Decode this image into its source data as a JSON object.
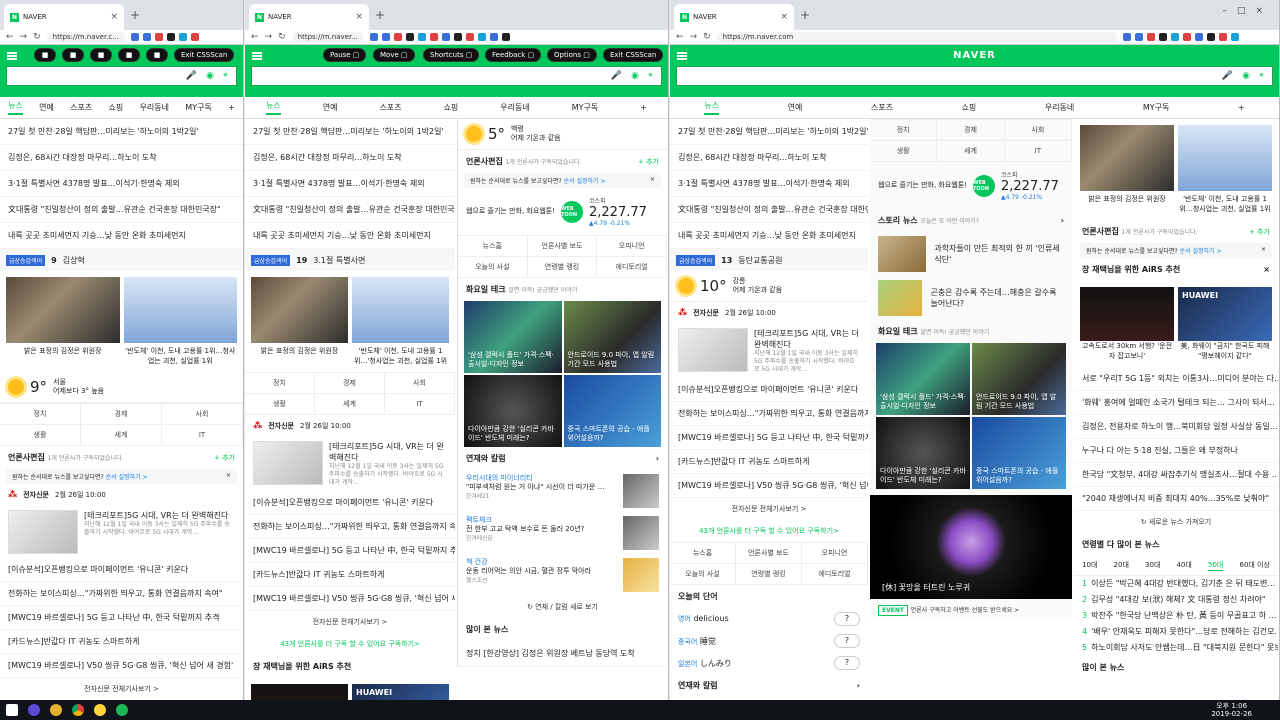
{
  "browser": {
    "tab_title": "NAVER",
    "url_short": "https://m.naver.c...",
    "url_mid": "https://m.naver...",
    "url_full": "https://m.naver.com"
  },
  "cssscan": {
    "pause": "Pause",
    "move": "Move",
    "shortcuts": "Shortcuts",
    "feedback": "Feedback",
    "options": "Options",
    "exit": "Exit CSSScan"
  },
  "naver": {
    "logo": "NAVER",
    "tabs": [
      "뉴스",
      "연예",
      "스포츠",
      "쇼핑",
      "우리동네",
      "MY구독"
    ],
    "headlines": [
      "27일 첫 만찬·28일 핵담판…미리보는 '하노이의 1박2일'",
      "김정은, 68시간 대장정 마무리…하노이 도착",
      "3·1절 특별사면 4378명 발표…이석기·한명숙 제외",
      "文대통령 \"친일청산이 정의 출발…유관순 건국훈장 대한민국장\"",
      "내륙 곳곳 초미세먼지 기승…낮 동안 온화  초미세먼지"
    ],
    "rank_badge": "급상승검색어",
    "rank_w1": {
      "num": "9",
      "word": "김상혁"
    },
    "rank_w2": {
      "num": "19",
      "word": "3.1절 특별사면"
    },
    "rank_w3": {
      "num": "13",
      "word": "동탄교통공원"
    },
    "photo_cap_1": "밝은 표정의 김정은 위원장",
    "photo_cap_2": "'반도체' 이천, 도내 고용률 1위…'청사업는 괴천, 실업률 1위",
    "photo_cap_2b": "'반도체' 이천, 도내 고용률 1위…청사업는 괴천, 실업률 1위",
    "weather_w1": {
      "temp": "9°",
      "city": "서울",
      "desc": "어제보다 3° 높음"
    },
    "weather_w2": {
      "temp": "5°",
      "city": "백령",
      "desc": "어제 기온과 같음"
    },
    "weather_w3": {
      "temp": "10°",
      "city": "강릉",
      "desc": "어제 기온과 같음"
    },
    "cats": [
      "정치",
      "경제",
      "사회",
      "생활",
      "세계",
      "IT"
    ],
    "editor_title": "언론사편집",
    "editor_sub": "1개 언론사가 구독되었습니다.",
    "editor_add": "+ 추가",
    "notice": "원하는 순서대로 뉴스를 보고싶다면?",
    "notice_link": "순서 설정하기 >",
    "press_name": "전자신문",
    "press_date": "2월 26일 10:00",
    "feature_title": "[테크리포트]5G 시대, VR는 더 완벽해진다",
    "feature_title_w1": "[테크리포트]5G 시대, VR는 더 완벽해진다",
    "feature_sub": "지난해 12월 1일 국내 이동 3사는 일제히 5G 주파수를 송출하기 시작했다. 바야흐로 5G 시대가 개막…",
    "press_list": [
      "[이슈분석]오픈뱅킹으로 마이페이먼트 '유니콘' 키운다",
      "전화하는 보이스피싱…\"가짜위한 띄우고, 통화 연결음까지 속여\"",
      "[MWC19 바르셀로나] 5G 등고 나타난 中, 한국 턱밑까지 추격",
      "[카드뉴스]반값다 IT 귀농도 스마트하게",
      "[MWC19 바르셀로나] V50 씽큐 5G·G8 씽큐, '혁신 넘어 새 경험'"
    ],
    "press_more": "전자신문 전체기사보기 >",
    "sub_count": "43개 언론사를 더 구독 할 수 있어요",
    "sub_link": "구독하기>",
    "ad_title": "장 재택님을 위한 AiRS 추천",
    "ad_night": "고속도로서 30km 서행? '운전자 잡고보니'",
    "kospi": {
      "label": "코스피",
      "value": "2,227.77",
      "change": "▲4.79 -0.21%"
    },
    "webtoon_text": "웹으로 즐기는 만화, 화요웹툰!",
    "webtoon_badge": "WEB TOON",
    "press_links": [
      "뉴스홈",
      "언론사별 보도",
      "오피니언",
      "오늘의 사설",
      "연령별 랭킹",
      "에디토리얼"
    ],
    "tech_title": "화요일 테크",
    "tech_sub": "알면 이득! 궁금했던 이야기",
    "tech": [
      "'삼성 갤럭시 폴드' 가격·스펙·출시일·디자인 정보",
      "안드로이드 9.0 파이, 앱 알림 기간 모드 사용법",
      "다이아만큼 강한 '실리콘 카바이드' 반도체 미래는?",
      "중국 스마트폰의 공습 - 애플 위어설음까?"
    ],
    "column_title": "연재와 칼럼",
    "columns": [
      {
        "tag": "우리시대의 마이너리티",
        "title": "\"피부색처럼 원는 거 아냐\" 시선이 더 따가운 …",
        "src": "한겨레21"
      },
      {
        "tag": "팩트체크",
        "title": "전 한부 고교 탁액 보수로 돈 둘러 20년?",
        "src": "한겨레신문"
      },
      {
        "tag": "책 건강",
        "title": "운동 리어먹는 의안 시금, 혈관 장투 막아라",
        "src": "헬스조선"
      }
    ],
    "refresh": "연재 / 칼럼 새로 보기",
    "popular": "많이 본 뉴스",
    "popular_item": "정치  [한강영상] 김정은 위원장 베트남 동당역 도착",
    "word_title": "오늘의 단어",
    "words": [
      {
        "lang": "영어",
        "word": "delicious"
      },
      {
        "lang": "중국어",
        "word": "睡觉"
      },
      {
        "lang": "일본어",
        "word": "しんみり"
      }
    ],
    "word_q": "?",
    "story_title": "스토리 뉴스",
    "story_sub": "오늘은 또 어떤 이야기?",
    "stories": [
      "과학자들이 만든 최적의 한 끼 '인류세 식단'",
      "곤충은 감수록 주는데…해충은 갈수록 늘어난다?"
    ],
    "flower_cap": "[休] 꽃망울 터트린 노루귀",
    "event_badge": "EVENT",
    "event_text": "언론사 구독하고 아벤트 선물도 받으세요 >",
    "huawei": "HUAWEI",
    "right_news": [
      "서로 \"우리T 5G 1등\" 외치는 이통3사…미디어 분야는 다…",
      "'화웨' 홍여에 얼떼인 소국가 털테크 되는… 그사이 되서…",
      "김정은, 전용차로 하노이 행…북미회담 일정 사실상 동일…",
      "누구나 다 아는 5·18 진실, 그들은 왜 부정하나",
      "한국당 \"文청부, 4대강 싸잡추기식 맹실조사…절대 수용 …",
      "\"2040 재생에너지 비중 최대치 40%…35%로 낮춰야\""
    ],
    "right_more": "새로운 뉴스 가져오기",
    "age_title": "연령별 다 많이 본 뉴스",
    "ages": [
      "10대",
      "20대",
      "30대",
      "40대",
      "50대",
      "60대 이상"
    ],
    "age_rank": [
      "이상든 \"박근혜 4대강 반대했다, 김기춘 은 뒤 태도변…",
      "김무성 \"4대강 보(洑) 해체? 文 대통령 정신 차려야\"",
      "박찬주 \"한국당 난맥상은 朴 탄, 黃 등이 무골표고 하 …",
      "'배우' 안재욱도 피해자 못한다\"…당로 전해하는 김건모…",
      "하노이회담 사저도 안쌤는데…日 \"대북지원 문한다\" 못보"
    ],
    "airs_caption_1": "고속도로서 30km 서행? '운전자 잡고보니'",
    "airs_caption_2": "美, 화웨이 \"금지\" 한국도 피해 \"평보헤이지 같다\"",
    "taskbar_time": "오후 1:06",
    "taskbar_date": "2019-02-26"
  },
  "colors": {
    "naver_green": "#03c75a",
    "link_blue": "#1a7de0"
  }
}
